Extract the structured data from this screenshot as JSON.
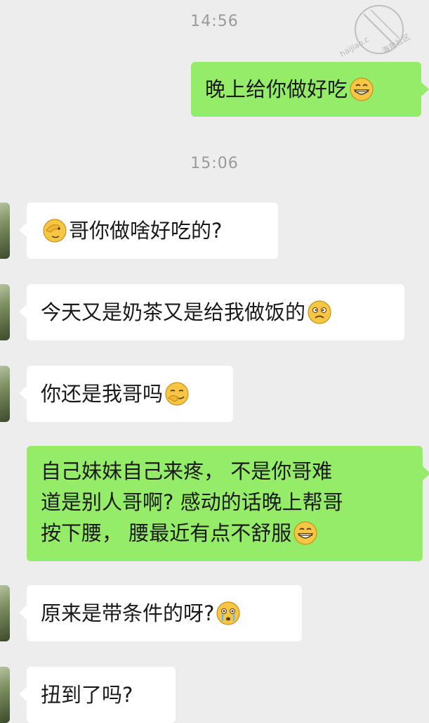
{
  "watermark": {
    "line1": "海角社区",
    "line2": "haijiao.c"
  },
  "messages": [
    {
      "type": "time",
      "text": "14:56"
    },
    {
      "type": "msg",
      "side": "right",
      "text": "晚上给你做好吃",
      "emoji_after": "grin-emoji"
    },
    {
      "type": "time",
      "text": "15:06"
    },
    {
      "type": "msg",
      "side": "left",
      "emoji_before": "facepalm-emoji",
      "text": "哥你做啥好吃的?"
    },
    {
      "type": "msg",
      "side": "left",
      "text": "今天又是奶茶又是给我做饭的",
      "emoji_after": "confused-emoji"
    },
    {
      "type": "msg",
      "side": "left",
      "text": "你还是我哥吗",
      "emoji_after": "smirk-emoji"
    },
    {
      "type": "msg",
      "side": "right",
      "lines": [
        "自己妹妹自己来疼， 不是你哥难",
        "道是别人哥啊? 感动的话晚上帮哥",
        "按下腰， 腰最近有点不舒服"
      ],
      "emoji_after": "grin-emoji"
    },
    {
      "type": "msg",
      "side": "left",
      "text": "原来是带条件的呀?",
      "emoji_after": "tearful-emoji"
    },
    {
      "type": "msg",
      "side": "left",
      "text": "扭到了吗?"
    }
  ]
}
